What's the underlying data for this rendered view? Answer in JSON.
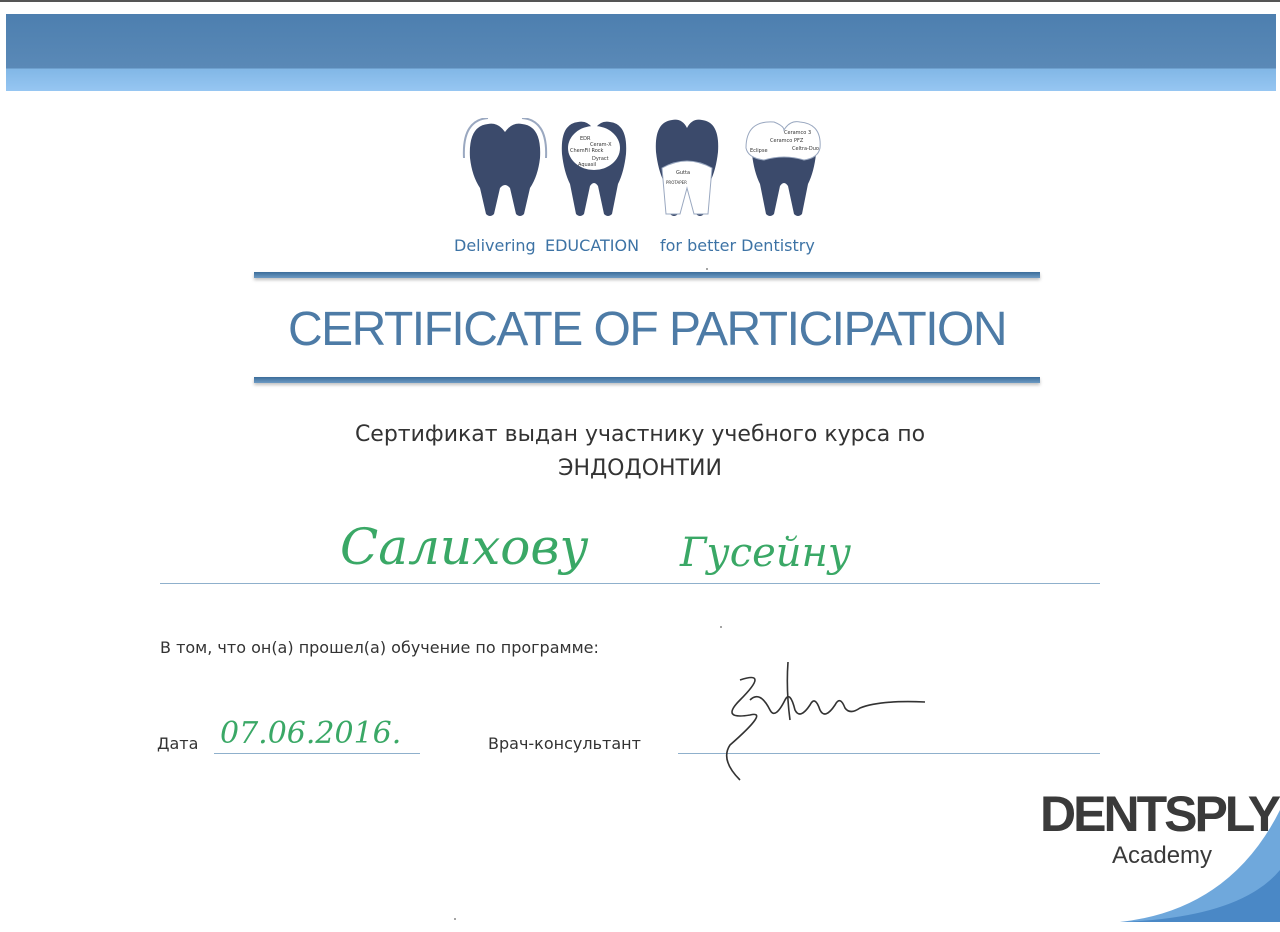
{
  "logo": {
    "tagline_left": "Delivering",
    "tagline_mid": "EDUCATION",
    "tagline_right": "for better Dentistry"
  },
  "certificate": {
    "title": "CERTIFICATE OF PARTICIPATION",
    "subtitle_line1": "Сертификат выдан участнику учебного курса по",
    "subtitle_line2": "ЭНДОДОНТИИ",
    "recipient_surname": "Салихову",
    "recipient_name": "Гусейну",
    "program_text": "В том, что он(а) прошел(а) обучение по программе:",
    "date_label": "Дата",
    "date_value": "07.06.2016.",
    "consultant_label": "Врач-консультант"
  },
  "brand": {
    "name": "DENTSPLY",
    "sub": "Academy"
  },
  "colors": {
    "banner_blue": "#5a89b7",
    "title_blue": "#4d7ba6",
    "ink_green": "#3aa866"
  }
}
